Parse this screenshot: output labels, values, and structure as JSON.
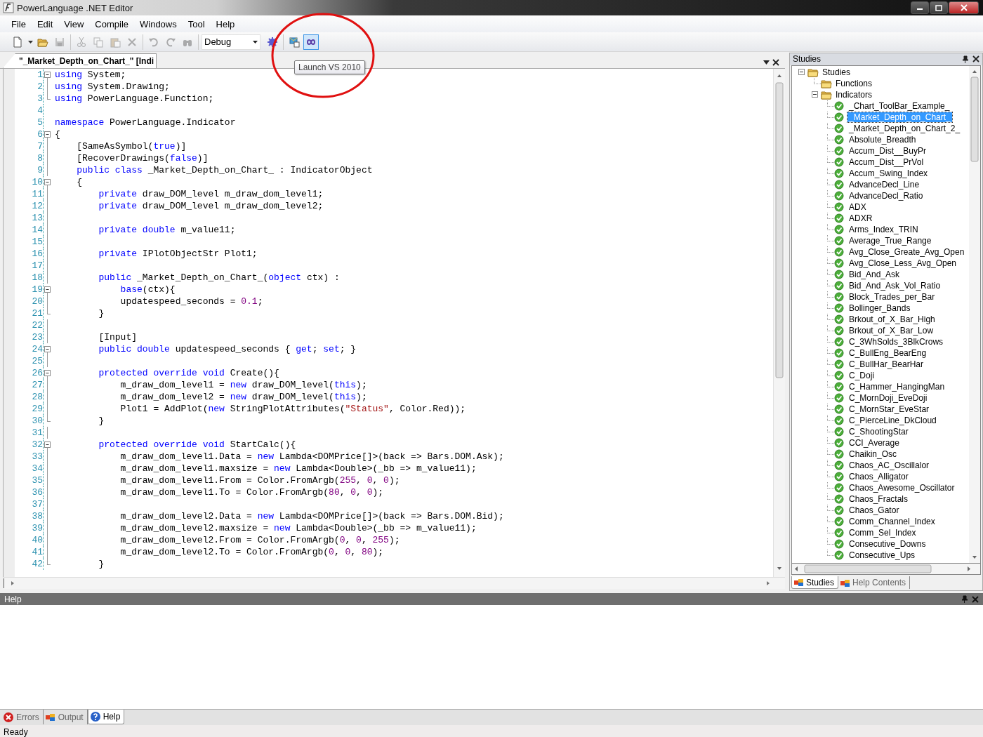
{
  "window": {
    "title": "PowerLanguage .NET Editor",
    "tooltip": "Launch VS 2010"
  },
  "menu": [
    {
      "label": "File"
    },
    {
      "label": "Edit"
    },
    {
      "label": "View"
    },
    {
      "label": "Compile"
    },
    {
      "label": "Windows"
    },
    {
      "label": "Tool"
    },
    {
      "label": "Help"
    }
  ],
  "toolbar": [
    {
      "buttons": [
        {
          "kind": "new",
          "disabled": false,
          "pressed": false
        },
        {
          "kind": "dropdown",
          "disabled": false,
          "pressed": false
        },
        {
          "kind": "open",
          "disabled": false,
          "pressed": false
        },
        {
          "kind": "save",
          "disabled": true,
          "pressed": false
        }
      ]
    },
    {
      "buttons": [
        {
          "kind": "cut",
          "disabled": true,
          "pressed": false
        },
        {
          "kind": "copy",
          "disabled": true,
          "pressed": false
        },
        {
          "kind": "paste",
          "disabled": true,
          "pressed": false
        },
        {
          "kind": "delete",
          "disabled": true,
          "pressed": false
        }
      ]
    },
    {
      "buttons": [
        {
          "kind": "undo",
          "disabled": true,
          "pressed": false
        },
        {
          "kind": "redo",
          "disabled": true,
          "pressed": false
        },
        {
          "kind": "find",
          "disabled": true,
          "pressed": false
        }
      ]
    },
    {
      "combo": "Debug",
      "buttons": [
        {
          "kind": "gear",
          "disabled": false,
          "pressed": false
        }
      ]
    },
    {
      "buttons": [
        {
          "kind": "package",
          "disabled": false,
          "pressed": false
        },
        {
          "kind": "infinity",
          "disabled": false,
          "pressed": true
        }
      ]
    }
  ],
  "document_tab": {
    "title": "\"_Market_Depth_on_Chart_\" [Indi"
  },
  "code_lines": [
    {
      "number": "1",
      "kind": "fold_start",
      "tokens": [
        {
          "kind": "keyword",
          "text": "using"
        },
        {
          "kind": "plain",
          "text": " System;"
        }
      ]
    },
    {
      "number": "2",
      "kind": "fold_body",
      "tokens": [
        {
          "kind": "keyword",
          "text": "using"
        },
        {
          "kind": "plain",
          "text": " System.Drawing;"
        }
      ]
    },
    {
      "number": "3",
      "kind": "fold_end",
      "tokens": [
        {
          "kind": "keyword",
          "text": "using"
        },
        {
          "kind": "plain",
          "text": " PowerLanguage.Function;"
        }
      ]
    },
    {
      "number": "4",
      "kind": "plain"
    },
    {
      "number": "5",
      "kind": "plain",
      "tokens": [
        {
          "kind": "keyword",
          "text": "namespace"
        },
        {
          "kind": "plain",
          "text": " PowerLanguage.Indicator"
        }
      ]
    },
    {
      "number": "6",
      "kind": "fold_start",
      "tokens": [
        {
          "kind": "plain",
          "text": "{"
        }
      ]
    },
    {
      "number": "7",
      "kind": "fold_body",
      "tokens": [
        {
          "kind": "plain",
          "text": "    [SameAsSymbol("
        },
        {
          "kind": "keyword",
          "text": "true"
        },
        {
          "kind": "plain",
          "text": ")]"
        }
      ]
    },
    {
      "number": "8",
      "kind": "fold_body",
      "tokens": [
        {
          "kind": "plain",
          "text": "    [RecoverDrawings("
        },
        {
          "kind": "keyword",
          "text": "false"
        },
        {
          "kind": "plain",
          "text": ")]"
        }
      ]
    },
    {
      "number": "9",
      "kind": "fold_body",
      "tokens": [
        {
          "kind": "keyword",
          "text": "    public"
        },
        {
          "kind": "keyword",
          "text": " class"
        },
        {
          "kind": "plain",
          "text": " _Market_Depth_on_Chart_ : IndicatorObject"
        }
      ]
    },
    {
      "number": "10",
      "kind": "fold_start",
      "tokens": [
        {
          "kind": "plain",
          "text": "    {"
        }
      ]
    },
    {
      "number": "11",
      "kind": "fold_body",
      "tokens": [
        {
          "kind": "keyword",
          "text": "        private"
        },
        {
          "kind": "plain",
          "text": " draw_DOM_level m_draw_dom_level1;"
        }
      ]
    },
    {
      "number": "12",
      "kind": "fold_body",
      "tokens": [
        {
          "kind": "keyword",
          "text": "        private"
        },
        {
          "kind": "plain",
          "text": " draw_DOM_level m_draw_dom_level2;"
        }
      ]
    },
    {
      "number": "13",
      "kind": "fold_body"
    },
    {
      "number": "14",
      "kind": "fold_body",
      "tokens": [
        {
          "kind": "keyword",
          "text": "        private"
        },
        {
          "kind": "keyword",
          "text": " double"
        },
        {
          "kind": "plain",
          "text": " m_value11;"
        }
      ]
    },
    {
      "number": "15",
      "kind": "fold_body"
    },
    {
      "number": "16",
      "kind": "fold_body",
      "tokens": [
        {
          "kind": "keyword",
          "text": "        private"
        },
        {
          "kind": "plain",
          "text": " IPlotObjectStr Plot1;"
        }
      ]
    },
    {
      "number": "17",
      "kind": "fold_body"
    },
    {
      "number": "18",
      "kind": "fold_body",
      "tokens": [
        {
          "kind": "keyword",
          "text": "        public"
        },
        {
          "kind": "plain",
          "text": " _Market_Depth_on_Chart_("
        },
        {
          "kind": "keyword",
          "text": "object"
        },
        {
          "kind": "plain",
          "text": " ctx) :"
        }
      ]
    },
    {
      "number": "19",
      "kind": "fold_start",
      "tokens": [
        {
          "kind": "keyword",
          "text": "            base"
        },
        {
          "kind": "plain",
          "text": "(ctx){"
        }
      ]
    },
    {
      "number": "20",
      "kind": "fold_body",
      "tokens": [
        {
          "kind": "plain",
          "text": "            updatespeed_seconds = "
        },
        {
          "kind": "number",
          "text": "0.1"
        },
        {
          "kind": "plain",
          "text": ";"
        }
      ]
    },
    {
      "number": "21",
      "kind": "fold_end",
      "tokens": [
        {
          "kind": "plain",
          "text": "        }"
        }
      ]
    },
    {
      "number": "22",
      "kind": "fold_body"
    },
    {
      "number": "23",
      "kind": "fold_body",
      "tokens": [
        {
          "kind": "plain",
          "text": "        [Input]"
        }
      ]
    },
    {
      "number": "24",
      "kind": "fold_start",
      "tokens": [
        {
          "kind": "keyword",
          "text": "        public"
        },
        {
          "kind": "keyword",
          "text": " double"
        },
        {
          "kind": "plain",
          "text": " updatespeed_seconds { "
        },
        {
          "kind": "keyword",
          "text": "get"
        },
        {
          "kind": "plain",
          "text": ";"
        },
        {
          "kind": "keyword",
          "text": " set"
        },
        {
          "kind": "plain",
          "text": "; }"
        }
      ]
    },
    {
      "number": "25",
      "kind": "fold_body"
    },
    {
      "number": "26",
      "kind": "fold_start",
      "tokens": [
        {
          "kind": "keyword",
          "text": "        protected"
        },
        {
          "kind": "keyword",
          "text": " override"
        },
        {
          "kind": "keyword",
          "text": " void"
        },
        {
          "kind": "plain",
          "text": " Create(){"
        }
      ]
    },
    {
      "number": "27",
      "kind": "fold_body",
      "tokens": [
        {
          "kind": "plain",
          "text": "            m_draw_dom_level1 = "
        },
        {
          "kind": "keyword",
          "text": "new"
        },
        {
          "kind": "plain",
          "text": " draw_DOM_level("
        },
        {
          "kind": "keyword",
          "text": "this"
        },
        {
          "kind": "plain",
          "text": ");"
        }
      ]
    },
    {
      "number": "28",
      "kind": "fold_body",
      "tokens": [
        {
          "kind": "plain",
          "text": "            m_draw_dom_level2 = "
        },
        {
          "kind": "keyword",
          "text": "new"
        },
        {
          "kind": "plain",
          "text": " draw_DOM_level("
        },
        {
          "kind": "keyword",
          "text": "this"
        },
        {
          "kind": "plain",
          "text": ");"
        }
      ]
    },
    {
      "number": "29",
      "kind": "fold_body",
      "tokens": [
        {
          "kind": "plain",
          "text": "            Plot1 = AddPlot("
        },
        {
          "kind": "keyword",
          "text": "new"
        },
        {
          "kind": "plain",
          "text": " StringPlotAttributes("
        },
        {
          "kind": "string",
          "text": "\"Status\""
        },
        {
          "kind": "plain",
          "text": ", Color.Red));"
        }
      ]
    },
    {
      "number": "30",
      "kind": "fold_end",
      "tokens": [
        {
          "kind": "plain",
          "text": "        }"
        }
      ]
    },
    {
      "number": "31",
      "kind": "fold_body"
    },
    {
      "number": "32",
      "kind": "fold_start",
      "tokens": [
        {
          "kind": "keyword",
          "text": "        protected"
        },
        {
          "kind": "keyword",
          "text": " override"
        },
        {
          "kind": "keyword",
          "text": " void"
        },
        {
          "kind": "plain",
          "text": " StartCalc(){"
        }
      ]
    },
    {
      "number": "33",
      "kind": "fold_body",
      "tokens": [
        {
          "kind": "plain",
          "text": "            m_draw_dom_level1.Data = "
        },
        {
          "kind": "keyword",
          "text": "new"
        },
        {
          "kind": "plain",
          "text": " Lambda<DOMPrice[]>(back => Bars.DOM.Ask);"
        }
      ]
    },
    {
      "number": "34",
      "kind": "fold_body",
      "tokens": [
        {
          "kind": "plain",
          "text": "            m_draw_dom_level1.maxsize = "
        },
        {
          "kind": "keyword",
          "text": "new"
        },
        {
          "kind": "plain",
          "text": " Lambda<Double>(_bb => m_value11);"
        }
      ]
    },
    {
      "number": "35",
      "kind": "fold_body",
      "tokens": [
        {
          "kind": "plain",
          "text": "            m_draw_dom_level1.From = Color.FromArgb("
        },
        {
          "kind": "number",
          "text": "255"
        },
        {
          "kind": "plain",
          "text": ", "
        },
        {
          "kind": "number",
          "text": "0"
        },
        {
          "kind": "plain",
          "text": ", "
        },
        {
          "kind": "number",
          "text": "0"
        },
        {
          "kind": "plain",
          "text": ");"
        }
      ]
    },
    {
      "number": "36",
      "kind": "fold_body",
      "tokens": [
        {
          "kind": "plain",
          "text": "            m_draw_dom_level1.To = Color.FromArgb("
        },
        {
          "kind": "number",
          "text": "80"
        },
        {
          "kind": "plain",
          "text": ", "
        },
        {
          "kind": "number",
          "text": "0"
        },
        {
          "kind": "plain",
          "text": ", "
        },
        {
          "kind": "number",
          "text": "0"
        },
        {
          "kind": "plain",
          "text": ");"
        }
      ]
    },
    {
      "number": "37",
      "kind": "fold_body"
    },
    {
      "number": "38",
      "kind": "fold_body",
      "tokens": [
        {
          "kind": "plain",
          "text": "            m_draw_dom_level2.Data = "
        },
        {
          "kind": "keyword",
          "text": "new"
        },
        {
          "kind": "plain",
          "text": " Lambda<DOMPrice[]>(back => Bars.DOM.Bid);"
        }
      ]
    },
    {
      "number": "39",
      "kind": "fold_body",
      "tokens": [
        {
          "kind": "plain",
          "text": "            m_draw_dom_level2.maxsize = "
        },
        {
          "kind": "keyword",
          "text": "new"
        },
        {
          "kind": "plain",
          "text": " Lambda<Double>(_bb => m_value11);"
        }
      ]
    },
    {
      "number": "40",
      "kind": "fold_body",
      "tokens": [
        {
          "kind": "plain",
          "text": "            m_draw_dom_level2.From = Color.FromArgb("
        },
        {
          "kind": "number",
          "text": "0"
        },
        {
          "kind": "plain",
          "text": ", "
        },
        {
          "kind": "number",
          "text": "0"
        },
        {
          "kind": "plain",
          "text": ", "
        },
        {
          "kind": "number",
          "text": "255"
        },
        {
          "kind": "plain",
          "text": ");"
        }
      ]
    },
    {
      "number": "41",
      "kind": "fold_body",
      "tokens": [
        {
          "kind": "plain",
          "text": "            m_draw_dom_level2.To = Color.FromArgb("
        },
        {
          "kind": "number",
          "text": "0"
        },
        {
          "kind": "plain",
          "text": ", "
        },
        {
          "kind": "number",
          "text": "0"
        },
        {
          "kind": "plain",
          "text": ", "
        },
        {
          "kind": "number",
          "text": "80"
        },
        {
          "kind": "plain",
          "text": ");"
        }
      ]
    },
    {
      "number": "42",
      "kind": "fold_end",
      "tokens": [
        {
          "kind": "plain",
          "text": "        }"
        }
      ]
    }
  ],
  "studies_panel": {
    "title": "Studies",
    "tree": [
      {
        "label": "Studies",
        "kind": "folder",
        "expanded": true,
        "selected": false,
        "children": [
          {
            "label": "Functions",
            "kind": "folder",
            "selected": false
          },
          {
            "label": "Indicators",
            "kind": "folder",
            "expanded": true,
            "selected": false,
            "children": [
              {
                "label": "_Chart_ToolBar_Example_",
                "kind": "study",
                "selected": false
              },
              {
                "label": "_Market_Depth_on_Chart_",
                "kind": "study",
                "selected": true
              },
              {
                "label": "_Market_Depth_on_Chart_2_",
                "kind": "study",
                "selected": false
              },
              {
                "label": "Absolute_Breadth",
                "kind": "study",
                "selected": false
              },
              {
                "label": "Accum_Dist__BuyPr",
                "kind": "study",
                "selected": false
              },
              {
                "label": "Accum_Dist__PrVol",
                "kind": "study",
                "selected": false
              },
              {
                "label": "Accum_Swing_Index",
                "kind": "study",
                "selected": false
              },
              {
                "label": "AdvanceDecl_Line",
                "kind": "study",
                "selected": false
              },
              {
                "label": "AdvanceDecl_Ratio",
                "kind": "study",
                "selected": false
              },
              {
                "label": "ADX",
                "kind": "study",
                "selected": false
              },
              {
                "label": "ADXR",
                "kind": "study",
                "selected": false
              },
              {
                "label": "Arms_Index_TRIN",
                "kind": "study",
                "selected": false
              },
              {
                "label": "Average_True_Range",
                "kind": "study",
                "selected": false
              },
              {
                "label": "Avg_Close_Greate_Avg_Open",
                "kind": "study",
                "selected": false
              },
              {
                "label": "Avg_Close_Less_Avg_Open",
                "kind": "study",
                "selected": false
              },
              {
                "label": "Bid_And_Ask",
                "kind": "study",
                "selected": false
              },
              {
                "label": "Bid_And_Ask_Vol_Ratio",
                "kind": "study",
                "selected": false
              },
              {
                "label": "Block_Trades_per_Bar",
                "kind": "study",
                "selected": false
              },
              {
                "label": "Bollinger_Bands",
                "kind": "study",
                "selected": false
              },
              {
                "label": "Brkout_of_X_Bar_High",
                "kind": "study",
                "selected": false
              },
              {
                "label": "Brkout_of_X_Bar_Low",
                "kind": "study",
                "selected": false
              },
              {
                "label": "C_3WhSolds_3BlkCrows",
                "kind": "study",
                "selected": false
              },
              {
                "label": "C_BullEng_BearEng",
                "kind": "study",
                "selected": false
              },
              {
                "label": "C_BullHar_BearHar",
                "kind": "study",
                "selected": false
              },
              {
                "label": "C_Doji",
                "kind": "study",
                "selected": false
              },
              {
                "label": "C_Hammer_HangingMan",
                "kind": "study",
                "selected": false
              },
              {
                "label": "C_MornDoji_EveDoji",
                "kind": "study",
                "selected": false
              },
              {
                "label": "C_MornStar_EveStar",
                "kind": "study",
                "selected": false
              },
              {
                "label": "C_PierceLine_DkCloud",
                "kind": "study",
                "selected": false
              },
              {
                "label": "C_ShootingStar",
                "kind": "study",
                "selected": false
              },
              {
                "label": "CCI_Average",
                "kind": "study",
                "selected": false
              },
              {
                "label": "Chaikin_Osc",
                "kind": "study",
                "selected": false
              },
              {
                "label": "Chaos_AC_Oscillalor",
                "kind": "study",
                "selected": false
              },
              {
                "label": "Chaos_Alligator",
                "kind": "study",
                "selected": false
              },
              {
                "label": "Chaos_Awesome_Oscillator",
                "kind": "study",
                "selected": false
              },
              {
                "label": "Chaos_Fractals",
                "kind": "study",
                "selected": false
              },
              {
                "label": "Chaos_Gator",
                "kind": "study",
                "selected": false
              },
              {
                "label": "Comm_Channel_Index",
                "kind": "study",
                "selected": false
              },
              {
                "label": "Comm_Sel_Index",
                "kind": "study",
                "selected": false
              },
              {
                "label": "Consecutive_Downs",
                "kind": "study",
                "selected": false
              },
              {
                "label": "Consecutive_Ups",
                "kind": "study",
                "selected": false
              }
            ]
          }
        ]
      }
    ],
    "tabs": [
      {
        "label": "Studies",
        "selected": true
      },
      {
        "label": "Help Contents",
        "selected": false
      }
    ]
  },
  "help_panel": {
    "title": "Help"
  },
  "bottom_tabs": [
    {
      "label": "Errors",
      "kind": "errors",
      "selected": false
    },
    {
      "label": "Output",
      "kind": "output",
      "selected": false
    },
    {
      "label": "Help",
      "kind": "help",
      "selected": true
    }
  ],
  "status_bar": {
    "text": "Ready"
  }
}
